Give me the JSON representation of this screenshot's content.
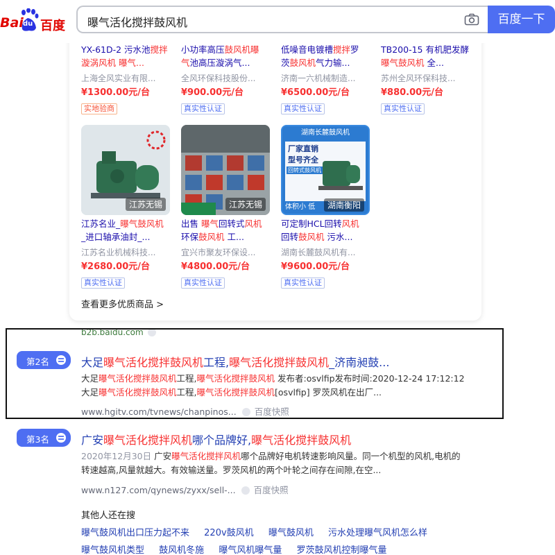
{
  "header": {
    "logo_text_1": "Bai",
    "logo_text_2": "du",
    "logo_text_3": "百度",
    "search_value": "曝气活化搅拌鼓风机",
    "search_button": "百度一下"
  },
  "products_row1": [
    {
      "title_a": "YX-61D-2 污水池",
      "title_b": "搅拌",
      "title_c": "",
      "title_d": "漩涡",
      "title_e": "风机 曝气...",
      "company": "上海全风实业有限...",
      "price": "¥1300.00元/台",
      "badge": "实地验商",
      "badge_style": "orange"
    },
    {
      "title_a": "小功率高压",
      "title_b": "鼓风机",
      "title_c": "",
      "title_d": "曝气",
      "title_e": "池高压漩涡气...",
      "company": "全风环保科技股份...",
      "price": "¥900.00元/台",
      "badge": "真实性认证",
      "badge_style": "blue"
    },
    {
      "title_a": "低噪音电镀槽",
      "title_b": "搅拌",
      "title_c": "罗茨",
      "title_d": "鼓风机",
      "title_e": "气力输...",
      "company": "济南一六机械制造...",
      "price": "¥6500.00元/台",
      "badge": "真实性认证",
      "badge_style": "blue"
    },
    {
      "title_a": "TB200-15 有机肥发酵",
      "title_b": "曝气",
      "title_c": "",
      "title_d": "鼓风机",
      "title_e": " 全...",
      "company": "苏州全风环保科技...",
      "price": "¥880.00元/台",
      "badge": "真实性认证",
      "badge_style": "blue"
    }
  ],
  "products_row2": [
    {
      "img_tag": "江苏无锡",
      "line1_a": "江苏名业_",
      "line1_b": "曝气鼓风机",
      "line2": "_进口轴承油封_...",
      "company": "江苏名业机械科技...",
      "price": "¥2680.00元/台",
      "badge": "真实性认证"
    },
    {
      "img_tag": "江苏无锡",
      "line1_a": "出售 ",
      "line1_b": "曝气",
      "line1_c": "回转式",
      "line1_d": "风机",
      "line2_a": "环保",
      "line2_b": "鼓风机",
      "line2_c": " 工...",
      "company": "宜兴市聚友环保设...",
      "price": "¥4800.00元/台",
      "badge": "真实性认证"
    },
    {
      "img_tag": "湖南衡阳",
      "img_title": "湖南长麓鼓风机",
      "img_line1": "厂家直销",
      "img_line2": "型号齐全",
      "img_line3": "回转式鼓风机",
      "img_footer": "体积小 低",
      "line1_a": "可定制HCL回转",
      "line1_b": "风机",
      "line2_a": "回转",
      "line2_b": "鼓风机",
      "line2_c": " 污水...",
      "company": "湖南长麓鼓风机有...",
      "price": "¥9600.00元/台",
      "badge": "真实性认证"
    }
  ],
  "more_products": "查看更多优质商品 >",
  "b2b_source": "b2b.baidu.com",
  "result2": {
    "rank": "第2名",
    "title_a": "大足",
    "title_b": "曝气活化搅拌鼓风机",
    "title_c": "工程,",
    "title_d": "曝气活化搅拌鼓风机",
    "title_e": "_济南昶鼓...",
    "l1_a": "大足",
    "l1_b": "曝气活化搅拌鼓风机",
    "l1_c": "工程,",
    "l1_d": "曝气活化搅拌鼓风机",
    "l1_e": " 发布者:osvlfip发布时间:2020-12-24 17:12:12",
    "l2_a": "大足",
    "l2_b": "曝气活化搅拌鼓风机",
    "l2_c": "工程,",
    "l2_d": "曝气活化搅拌鼓风机",
    "l2_e": "[osvlfip] 罗茨风机在出厂...",
    "url": "www.hgitv.com/tvnews/chanpinos...",
    "snapshot": "百度快照"
  },
  "result3": {
    "rank": "第3名",
    "title_a": "广安",
    "title_b": "曝气活化搅拌风机",
    "title_c": "哪个品牌好,",
    "title_d": "曝气活化搅拌鼓风机",
    "date": "2020年12月30日",
    "l1_a": " 广安",
    "l1_b": "曝气活化搅拌风机",
    "l1_c": "哪个品牌好电机转速影响风量。同一个机型的风机,电机的",
    "l2": "转速越高,风量就越大。有效输送量。罗茨风机的两个叶轮之间存在间隙,在空...",
    "url": "www.n127.com/qynews/zyxx/sell-...",
    "snapshot": "百度快照"
  },
  "related": {
    "title": "其他人还在搜",
    "row1": [
      "曝气鼓风机出口压力起不来",
      "220v鼓风机",
      "曝气鼓风机",
      "污水处理曝气风机怎么样"
    ],
    "row2": [
      "曝气鼓风机类型",
      "鼓风机冬施",
      "曝气风机曝气量",
      "罗茨鼓风机控制曝气量"
    ]
  },
  "colors": {
    "accent": "#4e6ef2",
    "highlight": "#f73131",
    "link": "#2440b3"
  }
}
